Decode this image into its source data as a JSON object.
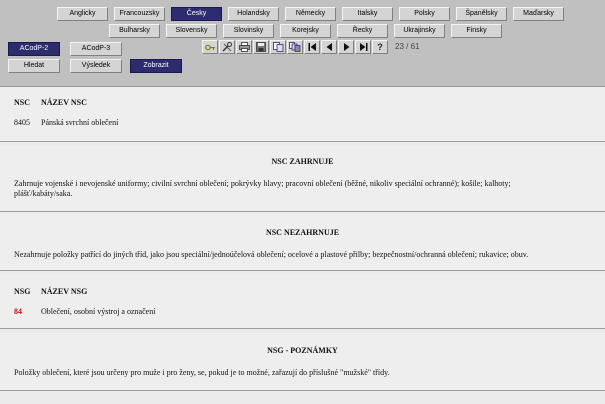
{
  "languages_row1": [
    {
      "label": "Anglicky",
      "active": false
    },
    {
      "label": "Francouzsky",
      "active": false
    },
    {
      "label": "Česky",
      "active": true
    },
    {
      "label": "Holandsky",
      "active": false
    },
    {
      "label": "Německy",
      "active": false
    },
    {
      "label": "Italsky",
      "active": false
    },
    {
      "label": "Polsky",
      "active": false
    },
    {
      "label": "Španělsky",
      "active": false
    },
    {
      "label": "Maďarsky",
      "active": false
    }
  ],
  "languages_row2": [
    {
      "label": "Bulharsky",
      "active": false
    },
    {
      "label": "Slovensky",
      "active": false
    },
    {
      "label": "Slovinsky",
      "active": false
    },
    {
      "label": "Korejsky",
      "active": false
    },
    {
      "label": "Řecky",
      "active": false
    },
    {
      "label": "Ukrajinsky",
      "active": false
    },
    {
      "label": "Finsky",
      "active": false
    }
  ],
  "acodp2_label": "ACodP-2",
  "acodp3_label": "ACodP-3",
  "hledat_label": "Hledat",
  "vysledek_label": "Výsledek",
  "zobrazit_label": "Zobrazit",
  "toolbar_icons": [
    "key-icon",
    "tools-icon",
    "print-icon",
    "save-icon",
    "copy-icon",
    "multi-copy-icon",
    "first-page-icon",
    "prev-page-icon",
    "next-page-icon",
    "last-page-icon",
    "help-icon"
  ],
  "pager": "23 / 61",
  "nsc": {
    "col_code": "NSC",
    "col_name": "NÁZEV NSC",
    "code": "8405",
    "name": "Pánská svrchní oblečení"
  },
  "zahrnuje": {
    "title": "NSC ZAHRNUJE",
    "text": "Zahrnuje vojenské i nevojenské uniformy; civilní svrchní oblečení; pokrývky hlavy; pracovní oblečení (běžné, nikoliv speciální ochranné); košile; kalhoty; plášť/kabáty/saka."
  },
  "nezahrnuje": {
    "title": "NSC NEZAHRNUJE",
    "text": "Nezahrnuje položky patřící do jiných tříd, jako jsou speciální/jednoúčelová oblečení; ocelové a plastové přilby; bezpečnostní/ochranná oblečení; rukavice; obuv."
  },
  "nsg": {
    "col_code": "NSG",
    "col_name": "NÁZEV NSG",
    "code": "84",
    "name": "Oblečení, osobní výstroj a označení"
  },
  "poznamky": {
    "title": "NSG - POZNÁMKY",
    "text": "Položky oblečení, které jsou určeny pro muže i pro ženy, se, pokud je to možné, zařazují do příslušné \"mužské\" třídy."
  },
  "colors": {
    "background": "#c0c0c0",
    "active_button": "#2c2c6e",
    "content_bg": "#eeeeee",
    "code_red": "#c01010"
  }
}
